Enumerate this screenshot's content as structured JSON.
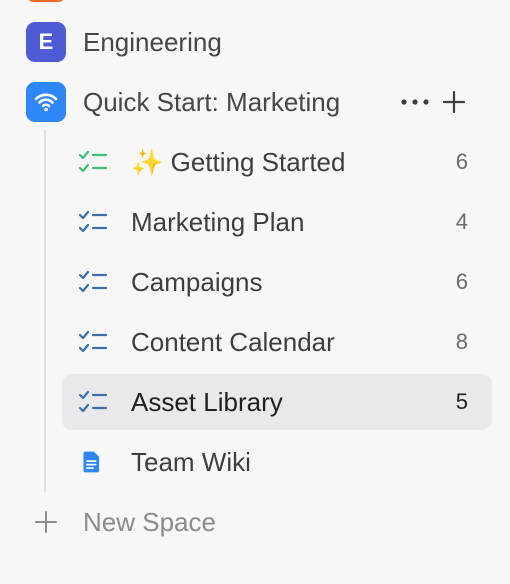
{
  "sidebar": {
    "spaces": [
      {
        "letter": "E",
        "label": "Engineering",
        "color": "#4f5bd5"
      },
      {
        "label": "Quick Start: Marketing",
        "color": "#2f86f6",
        "icon": "wifi-icon"
      }
    ],
    "items": [
      {
        "label": "✨ Getting Started",
        "count": "6",
        "icon": "checklist-green-icon"
      },
      {
        "label": "Marketing Plan",
        "count": "4",
        "icon": "checklist-icon"
      },
      {
        "label": "Campaigns",
        "count": "6",
        "icon": "checklist-icon"
      },
      {
        "label": "Content Calendar",
        "count": "8",
        "icon": "checklist-icon"
      },
      {
        "label": "Asset Library",
        "count": "5",
        "icon": "checklist-icon",
        "selected": true
      },
      {
        "label": "Team Wiki",
        "icon": "document-icon"
      }
    ],
    "new_space_label": "New Space"
  },
  "colors": {
    "accent_blue": "#2f86f6",
    "engineering": "#4f5bd5",
    "checklist_green": "#3bbf73",
    "checklist_blue": "#3a6fa8",
    "selected_bg": "#e9e9ec"
  }
}
